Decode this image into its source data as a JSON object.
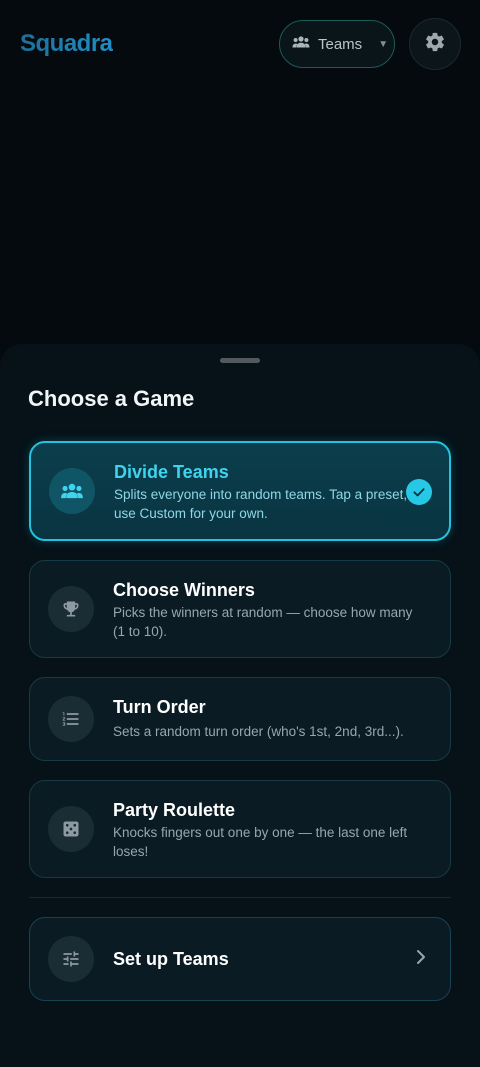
{
  "header": {
    "brand": "Squadra",
    "mode_label": "Teams"
  },
  "sheet": {
    "title": "Choose a Game",
    "games": [
      {
        "title": "Divide Teams",
        "description": "Splits everyone into random teams. Tap a preset, or use Custom for your own.",
        "icon": "groups-icon",
        "selected": true
      },
      {
        "title": "Choose Winners",
        "description": "Picks the winners at random — choose how many (1 to 10).",
        "icon": "trophy-icon",
        "selected": false
      },
      {
        "title": "Turn Order",
        "description": "Sets a random turn order (who's 1st, 2nd, 3rd...).",
        "icon": "numbered-list-icon",
        "selected": false
      },
      {
        "title": "Party Roulette",
        "description": "Knocks fingers out one by one — the last one left loses!",
        "icon": "dice-icon",
        "selected": false
      }
    ],
    "setup": {
      "label": "Set up Teams",
      "icon": "tune-icon"
    }
  },
  "colors": {
    "accent": "#22c3e0",
    "background": "#050a0e",
    "sheet": "#061118",
    "card": "#0a1b24"
  }
}
